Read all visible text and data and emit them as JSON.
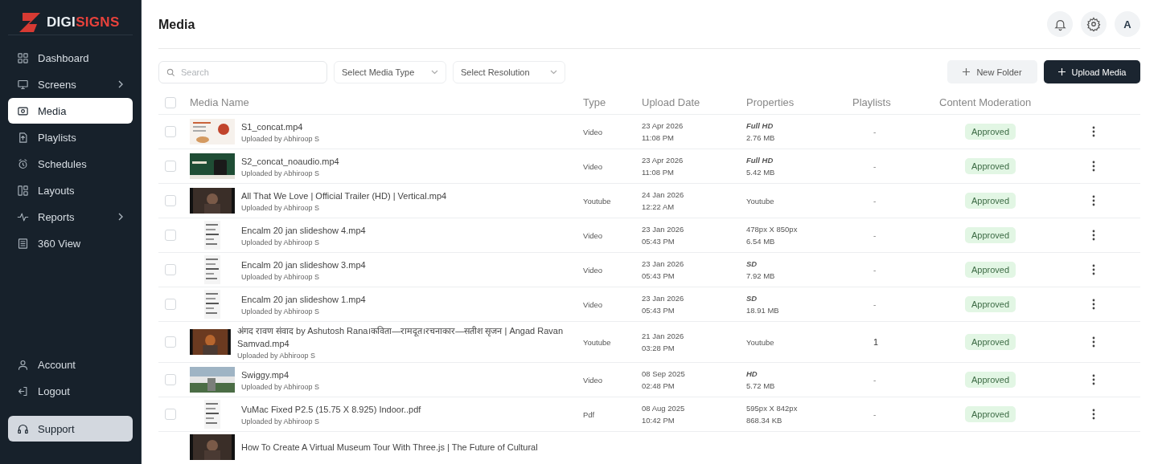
{
  "brand": {
    "name_first": "DIGI",
    "name_second": "SIGNS"
  },
  "sidebar": {
    "items": [
      {
        "label": "Dashboard",
        "selected": false,
        "has_submenu": false
      },
      {
        "label": "Screens",
        "selected": false,
        "has_submenu": true
      },
      {
        "label": "Media",
        "selected": true,
        "has_submenu": false
      },
      {
        "label": "Playlists",
        "selected": false,
        "has_submenu": false
      },
      {
        "label": "Schedules",
        "selected": false,
        "has_submenu": false
      },
      {
        "label": "Layouts",
        "selected": false,
        "has_submenu": false
      },
      {
        "label": "Reports",
        "selected": false,
        "has_submenu": true
      },
      {
        "label": "360 View",
        "selected": false,
        "has_submenu": false
      }
    ],
    "bottom_items": [
      {
        "label": "Account"
      },
      {
        "label": "Logout"
      }
    ],
    "support": {
      "label": "Support"
    }
  },
  "page_title": "Media",
  "avatar": "A",
  "toolbar": {
    "search": {
      "placeholder": "Search"
    },
    "filters": [
      "Select Media Type",
      "Select Resolution"
    ],
    "buttons": [
      {
        "label": "New Folder",
        "kind": "secondary"
      },
      {
        "label": "Upload Media",
        "kind": "primary"
      }
    ]
  },
  "table": {
    "select_all": {
      "checked": false
    },
    "columns": [
      "Media Name",
      "Type",
      "Upload Date",
      "Properties",
      "Playlists",
      "Content Moderation"
    ],
    "rows": [
      {
        "checked": false,
        "name": "S1_concat.mp4",
        "uploader": "Uploaded by Abhiroop S",
        "type": "Video",
        "date": "23 Apr 2026",
        "time": "11:08 PM",
        "properties": [
          {
            "kind": "quality",
            "text": "Full HD"
          },
          {
            "kind": "plain",
            "text": "2.76 MB"
          }
        ],
        "playlists": "-",
        "moderation": "Approved"
      },
      {
        "checked": false,
        "name": "S2_concat_noaudio.mp4",
        "uploader": "Uploaded by Abhiroop S",
        "type": "Video",
        "date": "23 Apr 2026",
        "time": "11:08 PM",
        "properties": [
          {
            "kind": "quality",
            "text": "Full HD"
          },
          {
            "kind": "plain",
            "text": "5.42 MB"
          }
        ],
        "playlists": "-",
        "moderation": "Approved"
      },
      {
        "checked": false,
        "name": "All That We Love | Official Trailer (HD) | Vertical.mp4",
        "uploader": "Uploaded by Abhiroop S",
        "type": "Youtube",
        "date": "24 Jan 2026",
        "time": "12:22 AM",
        "properties": [
          {
            "kind": "plain",
            "text": "Youtube"
          }
        ],
        "playlists": "-",
        "moderation": "Approved"
      },
      {
        "checked": false,
        "name": "Encalm 20 jan slideshow 4.mp4",
        "uploader": "Uploaded by Abhiroop S",
        "type": "Video",
        "date": "23 Jan 2026",
        "time": "05:43 PM",
        "properties": [
          {
            "kind": "plain",
            "text": "478px X 850px"
          },
          {
            "kind": "plain",
            "text": "6.54 MB"
          }
        ],
        "playlists": "-",
        "moderation": "Approved"
      },
      {
        "checked": false,
        "name": "Encalm 20 jan slideshow 3.mp4",
        "uploader": "Uploaded by Abhiroop S",
        "type": "Video",
        "date": "23 Jan 2026",
        "time": "05:43 PM",
        "properties": [
          {
            "kind": "quality",
            "text": "SD"
          },
          {
            "kind": "plain",
            "text": "7.92 MB"
          }
        ],
        "playlists": "-",
        "moderation": "Approved"
      },
      {
        "checked": false,
        "name": "Encalm 20 jan slideshow 1.mp4",
        "uploader": "Uploaded by Abhiroop S",
        "type": "Video",
        "date": "23 Jan 2026",
        "time": "05:43 PM",
        "properties": [
          {
            "kind": "quality",
            "text": "SD"
          },
          {
            "kind": "plain",
            "text": "18.91 MB"
          }
        ],
        "playlists": "-",
        "moderation": "Approved"
      },
      {
        "checked": false,
        "name": "अंगद रावण संवाद by Ashutosh Rana।कविता—रामदूत।रचनाकार—सतीश सृजन | Angad Ravan Samvad.mp4",
        "uploader": "Uploaded by Abhiroop S",
        "type": "Youtube",
        "date": "21 Jan 2026",
        "time": "03:28 PM",
        "properties": [
          {
            "kind": "plain",
            "text": "Youtube"
          }
        ],
        "playlists": "1",
        "moderation": "Approved"
      },
      {
        "checked": false,
        "name": "Swiggy.mp4",
        "uploader": "Uploaded by Abhiroop S",
        "type": "Video",
        "date": "08 Sep 2025",
        "time": "02:48 PM",
        "properties": [
          {
            "kind": "quality",
            "text": "HD"
          },
          {
            "kind": "plain",
            "text": "5.72 MB"
          }
        ],
        "playlists": "-",
        "moderation": "Approved"
      },
      {
        "checked": false,
        "name": "VuMac Fixed P2.5 (15.75 X 8.925) Indoor..pdf",
        "uploader": "Uploaded by Abhiroop S",
        "type": "Pdf",
        "date": "08 Aug 2025",
        "time": "10:42 PM",
        "properties": [
          {
            "kind": "plain",
            "text": "595px X 842px"
          },
          {
            "kind": "plain",
            "text": "868.34 KB"
          }
        ],
        "playlists": "-",
        "moderation": "Approved"
      },
      {
        "name": "How To Create A Virtual Museum Tour With Three.js | The Future of Cultural"
      }
    ]
  }
}
